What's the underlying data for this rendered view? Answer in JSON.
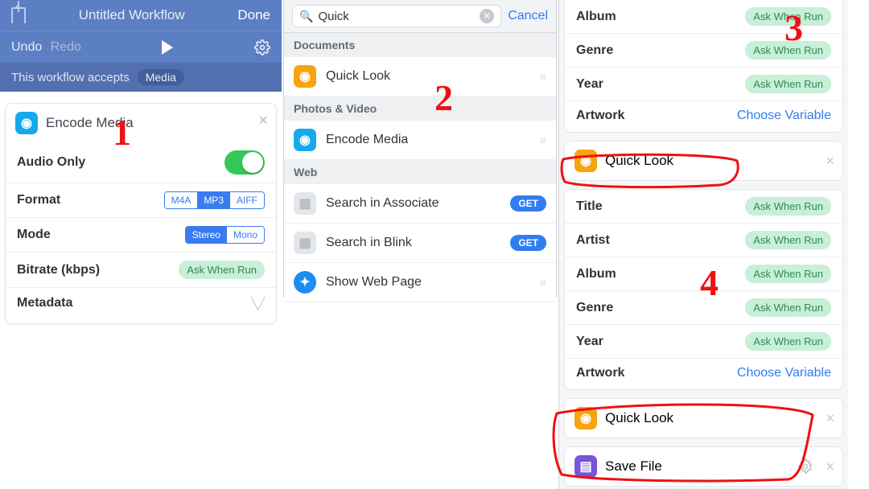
{
  "panel1": {
    "title": "Untitled Workflow",
    "done": "Done",
    "undo": "Undo",
    "redo": "Redo",
    "accepts_label": "This workflow accepts",
    "accepts_pill": "Media",
    "card_title": "Encode Media",
    "rows": {
      "audio_only": "Audio Only",
      "format": "Format",
      "format_opts": [
        "M4A",
        "MP3",
        "AIFF"
      ],
      "mode": "Mode",
      "mode_opts": [
        "Stereo",
        "Mono"
      ],
      "bitrate": "Bitrate (kbps)",
      "ask": "Ask When Run",
      "metadata": "Metadata"
    }
  },
  "panel2": {
    "query": "Quick",
    "cancel": "Cancel",
    "sections": {
      "documents": "Documents",
      "photos": "Photos & Video",
      "web": "Web"
    },
    "items": {
      "quick_look": "Quick Look",
      "encode_media": "Encode Media",
      "search_associate": "Search in Associate",
      "search_blink": "Search in Blink",
      "show_web_page": "Show Web Page",
      "get": "GET"
    }
  },
  "panel3": {
    "rows_top": {
      "album": "Album",
      "genre": "Genre",
      "year": "Year",
      "artwork": "Artwork"
    },
    "rows_mid": {
      "title": "Title",
      "artist": "Artist",
      "album": "Album",
      "genre": "Genre",
      "year": "Year",
      "artwork": "Artwork"
    },
    "ask": "Ask When Run",
    "choose": "Choose Variable",
    "quick_look": "Quick Look",
    "save_file": "Save File"
  },
  "annotations": {
    "n1": "1",
    "n2": "2",
    "n3": "3",
    "n4": "4"
  }
}
